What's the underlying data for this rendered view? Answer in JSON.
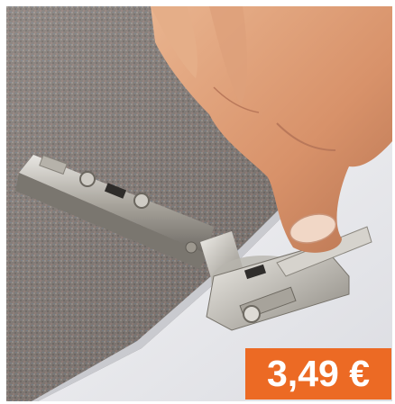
{
  "product_photo": {
    "subject": "concealed-cabinet-hinge-being-clipped-onto-white-door"
  },
  "price": {
    "label": "3,49 €",
    "badge_color": "#ec6a24",
    "text_color": "#ffffff"
  }
}
